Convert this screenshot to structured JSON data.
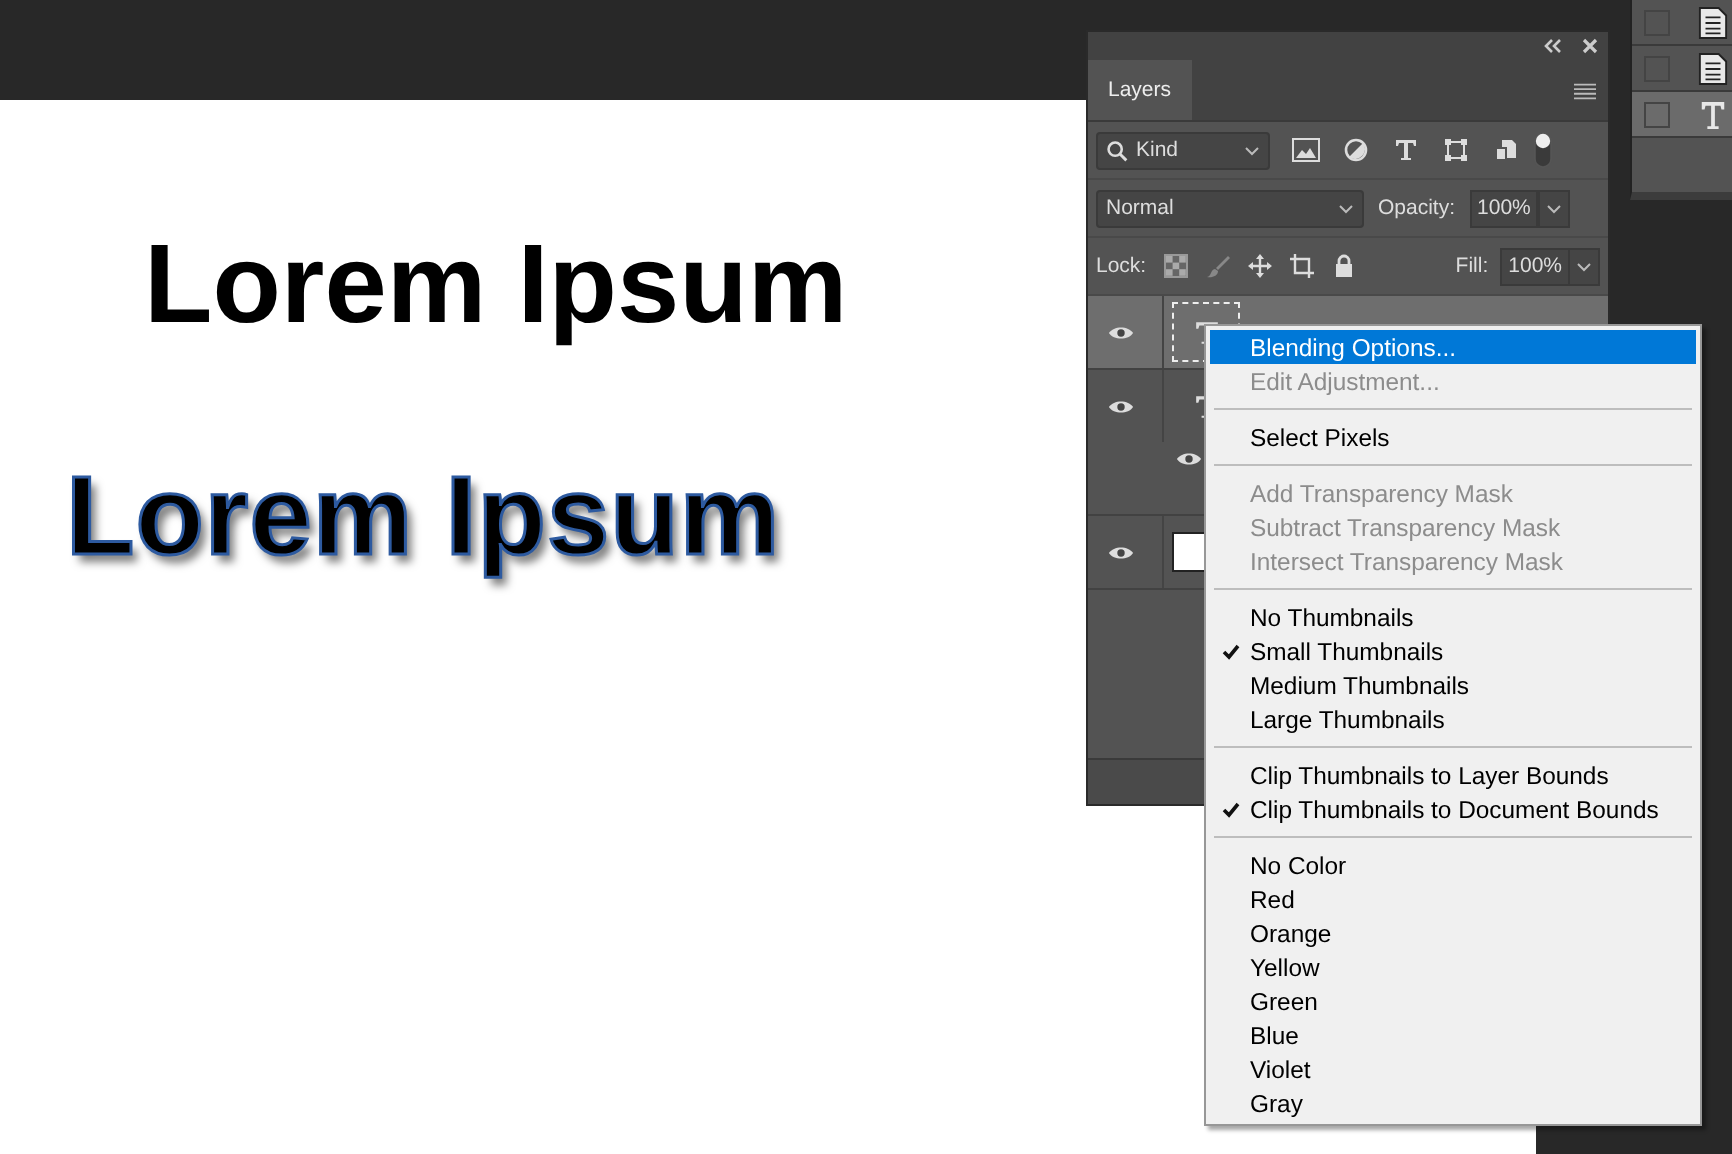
{
  "canvas": {
    "texts": [
      {
        "text": "Lorem Ipsum",
        "kind": "plain"
      },
      {
        "text": "Lorem Ipsum",
        "kind": "stroked"
      }
    ]
  },
  "side_panel": {
    "rows": [
      {
        "kind": "document",
        "selected": false
      },
      {
        "kind": "document",
        "selected": false
      },
      {
        "kind": "text",
        "selected": true
      }
    ]
  },
  "layers_panel": {
    "tab": "Layers",
    "filter": {
      "value": "Kind"
    },
    "blend_mode": {
      "value": "Normal"
    },
    "opacity": {
      "label": "Opacity:",
      "value": "100%"
    },
    "lock_label": "Lock:",
    "fill": {
      "label": "Fill:",
      "value": "100%"
    },
    "layers": [
      {
        "kind": "text",
        "selected": true,
        "effects": false
      },
      {
        "kind": "text",
        "selected": false,
        "effects": true
      },
      {
        "kind": "fill",
        "selected": false,
        "effects": false
      }
    ]
  },
  "context_menu": {
    "groups": [
      {
        "items": [
          {
            "label": "Blending Options...",
            "selected": true,
            "disabled": false,
            "checked": false
          },
          {
            "label": "Edit Adjustment...",
            "selected": false,
            "disabled": true,
            "checked": false
          }
        ]
      },
      {
        "items": [
          {
            "label": "Select Pixels",
            "selected": false,
            "disabled": false,
            "checked": false
          }
        ]
      },
      {
        "items": [
          {
            "label": "Add Transparency Mask",
            "selected": false,
            "disabled": true,
            "checked": false
          },
          {
            "label": "Subtract Transparency Mask",
            "selected": false,
            "disabled": true,
            "checked": false
          },
          {
            "label": "Intersect Transparency Mask",
            "selected": false,
            "disabled": true,
            "checked": false
          }
        ]
      },
      {
        "items": [
          {
            "label": "No Thumbnails",
            "selected": false,
            "disabled": false,
            "checked": false
          },
          {
            "label": "Small Thumbnails",
            "selected": false,
            "disabled": false,
            "checked": true
          },
          {
            "label": "Medium Thumbnails",
            "selected": false,
            "disabled": false,
            "checked": false
          },
          {
            "label": "Large Thumbnails",
            "selected": false,
            "disabled": false,
            "checked": false
          }
        ]
      },
      {
        "items": [
          {
            "label": "Clip Thumbnails to Layer Bounds",
            "selected": false,
            "disabled": false,
            "checked": false
          },
          {
            "label": "Clip Thumbnails to Document Bounds",
            "selected": false,
            "disabled": false,
            "checked": true
          }
        ]
      },
      {
        "items": [
          {
            "label": "No Color",
            "selected": false,
            "disabled": false,
            "checked": false
          },
          {
            "label": "Red",
            "selected": false,
            "disabled": false,
            "checked": false
          },
          {
            "label": "Orange",
            "selected": false,
            "disabled": false,
            "checked": false
          },
          {
            "label": "Yellow",
            "selected": false,
            "disabled": false,
            "checked": false
          },
          {
            "label": "Green",
            "selected": false,
            "disabled": false,
            "checked": false
          },
          {
            "label": "Blue",
            "selected": false,
            "disabled": false,
            "checked": false
          },
          {
            "label": "Violet",
            "selected": false,
            "disabled": false,
            "checked": false
          },
          {
            "label": "Gray",
            "selected": false,
            "disabled": false,
            "checked": false
          }
        ]
      }
    ]
  }
}
